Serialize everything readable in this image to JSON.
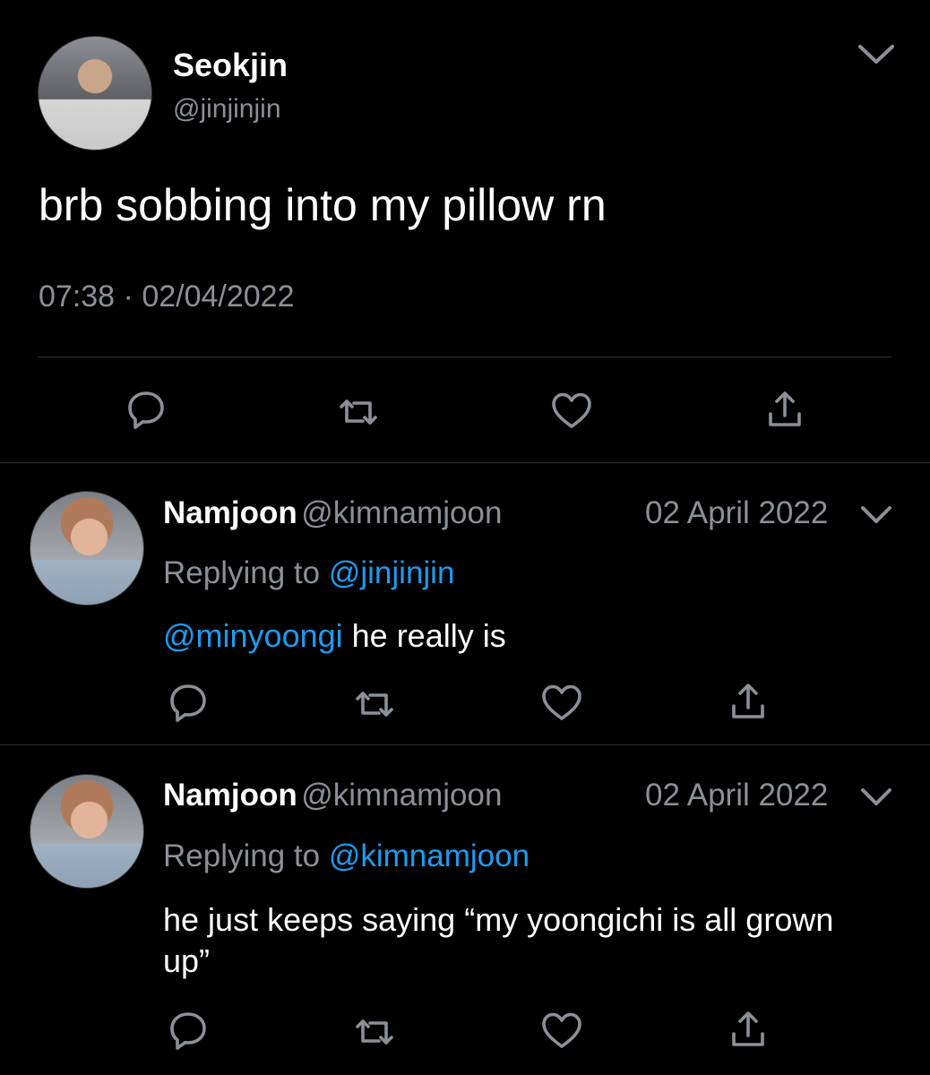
{
  "tweet": {
    "author_name": "Seokjin",
    "author_handle": "@jinjinjin",
    "text": "brb sobbing into my pillow rn",
    "time": "07:38",
    "dot": "·",
    "date": "02/04/2022"
  },
  "replies": [
    {
      "author_name": "Namjoon",
      "author_handle": "@kimnamjoon",
      "date": "02 April 2022",
      "replying_label": "Replying to",
      "replying_handle": "@jinjinjin",
      "mention": "@minyoongi",
      "text": " he really is"
    },
    {
      "author_name": "Namjoon",
      "author_handle": "@kimnamjoon",
      "date": "02 April 2022",
      "replying_label": "Replying to",
      "replying_handle": "@kimnamjoon",
      "text": "he just keeps saying “my yoongichi is all grown up”"
    }
  ],
  "icons": [
    "reply-icon",
    "retweet-icon",
    "like-icon",
    "share-icon",
    "chevron-down-icon"
  ],
  "colors": {
    "background": "#000000",
    "text": "#ffffff",
    "secondary": "#8b9096",
    "link": "#1d9bf0",
    "divider": "#2f3336"
  }
}
